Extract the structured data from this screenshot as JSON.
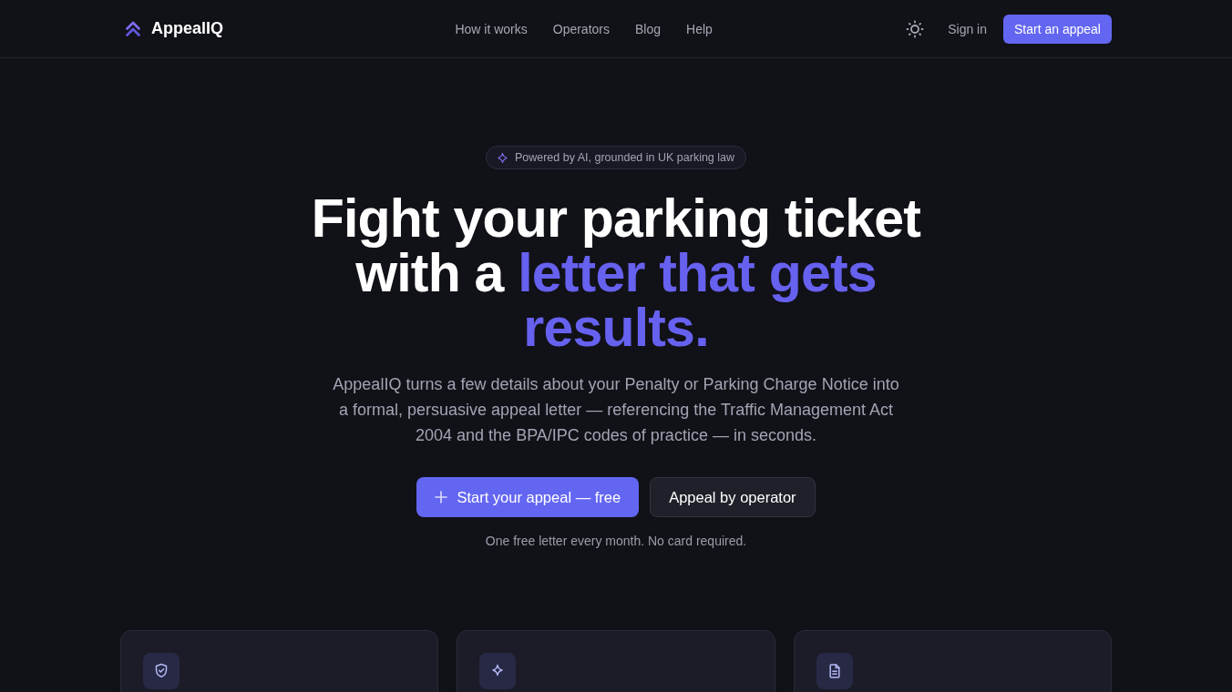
{
  "header": {
    "brand": "AppealIQ",
    "nav": [
      "How it works",
      "Operators",
      "Blog",
      "Help"
    ],
    "sign_in": "Sign in",
    "cta": "Start an appeal"
  },
  "hero": {
    "badge": "Powered by AI, grounded in UK parking law",
    "headline": {
      "text": "Fight your parking ticket with a",
      "accent": "letter that gets results."
    },
    "description": "AppealIQ turns a few details about your Penalty or Parking Charge Notice into a formal, persuasive appeal letter — referencing the Traffic Management Act 2004 and the BPA/IPC codes of practice — in seconds.",
    "primary_button": "Start your appeal — free",
    "secondary_button": "Appeal by operator",
    "note": "One free letter every month. No card required."
  },
  "feature_cards": [
    {
      "kind": "shield"
    },
    {
      "kind": "sparkle"
    },
    {
      "kind": "document"
    }
  ]
}
